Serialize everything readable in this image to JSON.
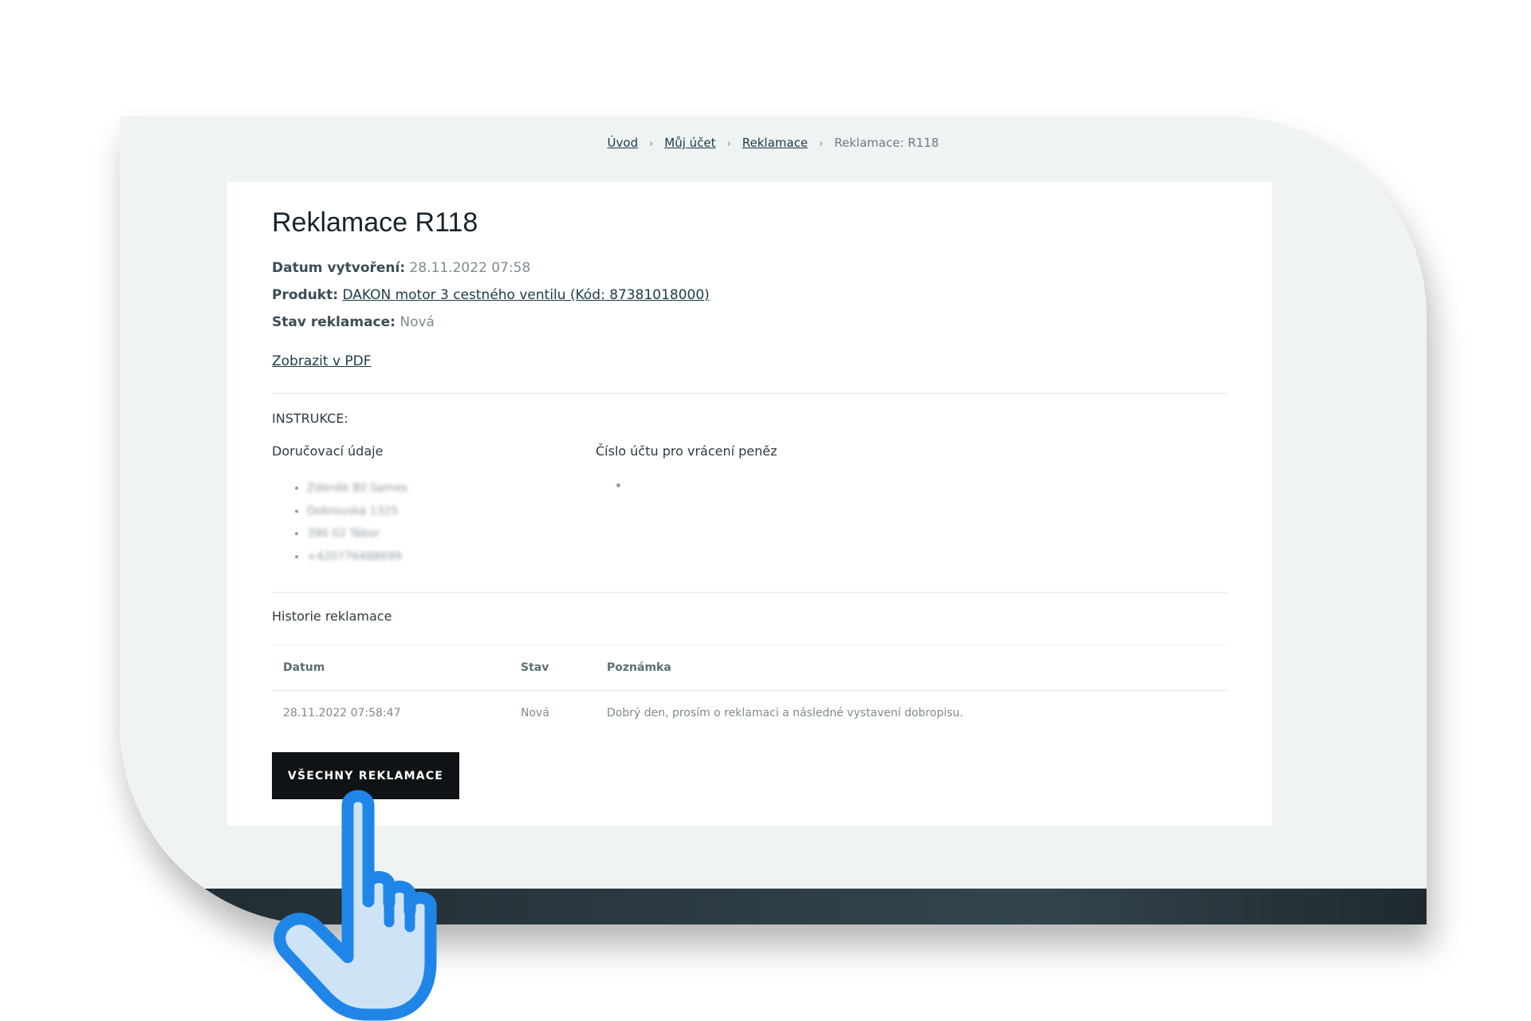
{
  "breadcrumb": {
    "items": [
      "Úvod",
      "Můj účet",
      "Reklamace"
    ],
    "current": "Reklamace: R118",
    "separator": "›"
  },
  "page": {
    "title": "Reklamace R118",
    "created_label": "Datum vytvoření:",
    "created_value": "28.11.2022 07:58",
    "product_label": "Produkt:",
    "product_value": "DAKON motor 3 cestného ventilu (Kód: 87381018000)",
    "status_label": "Stav reklamace:",
    "status_value": "Nová",
    "pdf_link": "Zobrazit v PDF"
  },
  "instructions": {
    "heading": "INSTRUKCE:",
    "delivery_heading": "Doručovací údaje",
    "delivery_items": [
      "Zdeněk Bil Sames",
      "Dobrovská 1325",
      "390 02 Tábor",
      "+420776488699"
    ],
    "account_heading": "Číslo účtu pro vrácení peněz",
    "account_items": [
      ""
    ]
  },
  "history": {
    "heading": "Historie reklamace",
    "columns": [
      "Datum",
      "Stav",
      "Poznámka"
    ],
    "rows": [
      [
        "28.11.2022 07:58:47",
        "Nová",
        "Dobrý den, prosím o reklamaci a následné vystavení dobropisu."
      ]
    ]
  },
  "button": {
    "all_claims": "VŠECHNY REKLAMACE"
  },
  "colors": {
    "frame_bg": "#eff3f4",
    "button_bg": "#101315",
    "hand_outline": "#1f86e8",
    "hand_fill": "#cfe3f7"
  },
  "icons": {
    "pointer": "hand-pointer-icon"
  }
}
